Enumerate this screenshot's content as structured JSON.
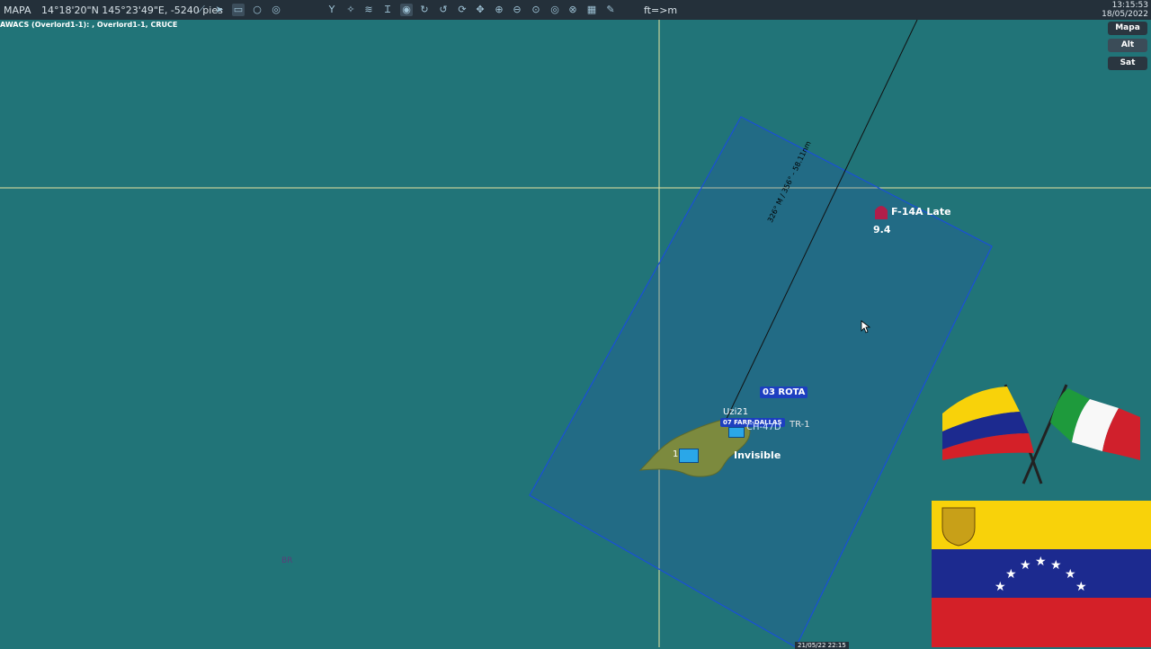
{
  "topbar": {
    "app_name": "MAPA",
    "coords": "14°18'20\"N 145°23'49\"E, -5240 pies",
    "unit_toggle": "ft=>m",
    "time": "13:15:53",
    "date": "18/05/2022",
    "icons": [
      "chart-icon",
      "plane-icon",
      "ruler-icon",
      "circle-icon",
      "layers-icon",
      "branch-icon",
      "target-icon",
      "signal-icon",
      "tower-icon",
      "radar-icon",
      "rotate-icon",
      "rotate-alt-icon",
      "rotate-3-icon",
      "move-icon",
      "zoom-in-icon",
      "zoom-out-icon",
      "zoom-fit-icon",
      "compass-icon",
      "globe-icon",
      "grid-icon",
      "pencil-icon"
    ]
  },
  "subtitle": "AWACS (Overlord1-1): , Overlord1-1, CRUCE",
  "map_types": {
    "mapa": "Mapa",
    "alt": "Alt",
    "sat": "Sat"
  },
  "map": {
    "line_label": "326° M / 356° - 58.11nm",
    "contacts": {
      "f14": {
        "name": "F-14A Late",
        "value": "9.4"
      },
      "rota": "03 ROTA",
      "uzi": "Uzi21",
      "farp": "07 FARP-DALLAS",
      "ch47": "CH-47D",
      "tr": "TR-1",
      "invisible_prefix": "1",
      "invisible": "Invisible",
      "mark_br": "BR",
      "bottom_label": "21/05/22 22:15"
    }
  },
  "colors": {
    "sea": "#217478",
    "box": "#1a4fd8",
    "crosshair": "#e8e5a0",
    "topbar": "#24303a"
  }
}
